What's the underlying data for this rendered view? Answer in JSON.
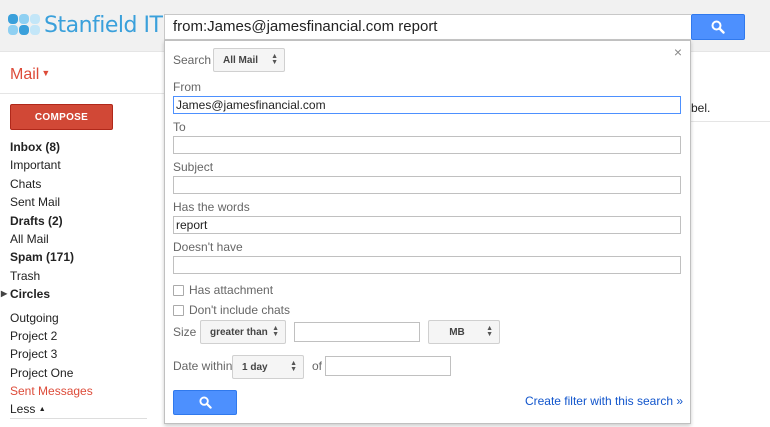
{
  "brand": {
    "name": "Stanfield IT"
  },
  "colors": {
    "accent_blue": "#4d90fe",
    "compose_red": "#d14836",
    "mail_red": "#dd4b39",
    "logo_blue": "#3aa0db"
  },
  "search": {
    "query": "from:James@jamesfinancial.com report",
    "icon": "search-icon"
  },
  "sidebar": {
    "mail_label": "Mail",
    "compose_label": "COMPOSE",
    "items": [
      {
        "label": "Inbox (8)"
      },
      {
        "label": "Important"
      },
      {
        "label": "Chats"
      },
      {
        "label": "Sent Mail"
      },
      {
        "label": "Drafts (2)"
      },
      {
        "label": "All Mail"
      },
      {
        "label": "Spam (171)"
      },
      {
        "label": "Trash"
      },
      {
        "label": "Circles"
      },
      {
        "label": "Outgoing"
      },
      {
        "label": "Project 2"
      },
      {
        "label": "Project 3"
      },
      {
        "label": "Project One"
      },
      {
        "label": "Sent Messages"
      },
      {
        "label": "Less"
      }
    ]
  },
  "background": {
    "label_snippet": "bel."
  },
  "advanced": {
    "close_symbol": "×",
    "search_label": "Search",
    "search_scope": "All Mail",
    "from_label": "From",
    "from_value": "James@jamesfinancial.com",
    "to_label": "To",
    "to_value": "",
    "subject_label": "Subject",
    "subject_value": "",
    "has_words_label": "Has the words",
    "has_words_value": "report",
    "doesnt_have_label": "Doesn't have",
    "doesnt_have_value": "",
    "has_attachment_label": "Has attachment",
    "no_chats_label": "Don't include chats",
    "size_label": "Size",
    "size_operator": "greater than",
    "size_unit": "MB",
    "date_label": "Date within",
    "date_range": "1 day",
    "of_label": "of",
    "create_filter_label": "Create filter with this search »"
  }
}
